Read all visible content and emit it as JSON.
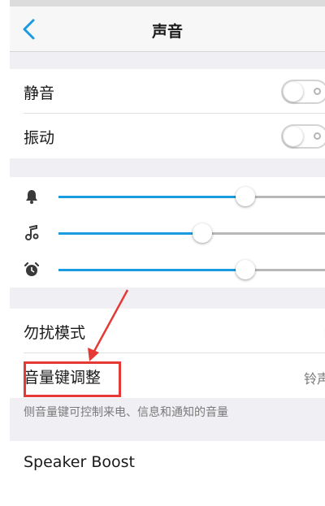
{
  "header": {
    "title": "声音",
    "back_icon": "chevron-left-icon"
  },
  "toggles": [
    {
      "label": "静音",
      "on": false
    },
    {
      "label": "振动",
      "on": false
    }
  ],
  "sliders": [
    {
      "icon": "bell-icon",
      "level": 0.7
    },
    {
      "icon": "music-note-icon",
      "level": 0.54
    },
    {
      "icon": "alarm-clock-icon",
      "level": 0.7
    }
  ],
  "settings": {
    "dnd_label": "勿扰模式",
    "volume_key_label": "音量键调整",
    "volume_key_value": "铃声",
    "hint": "侧音量键可控制来电、信息和通知的音量",
    "speaker_boost_label": "Speaker Boost"
  },
  "colors": {
    "accent": "#1a9be0",
    "highlight": "#e53935"
  }
}
